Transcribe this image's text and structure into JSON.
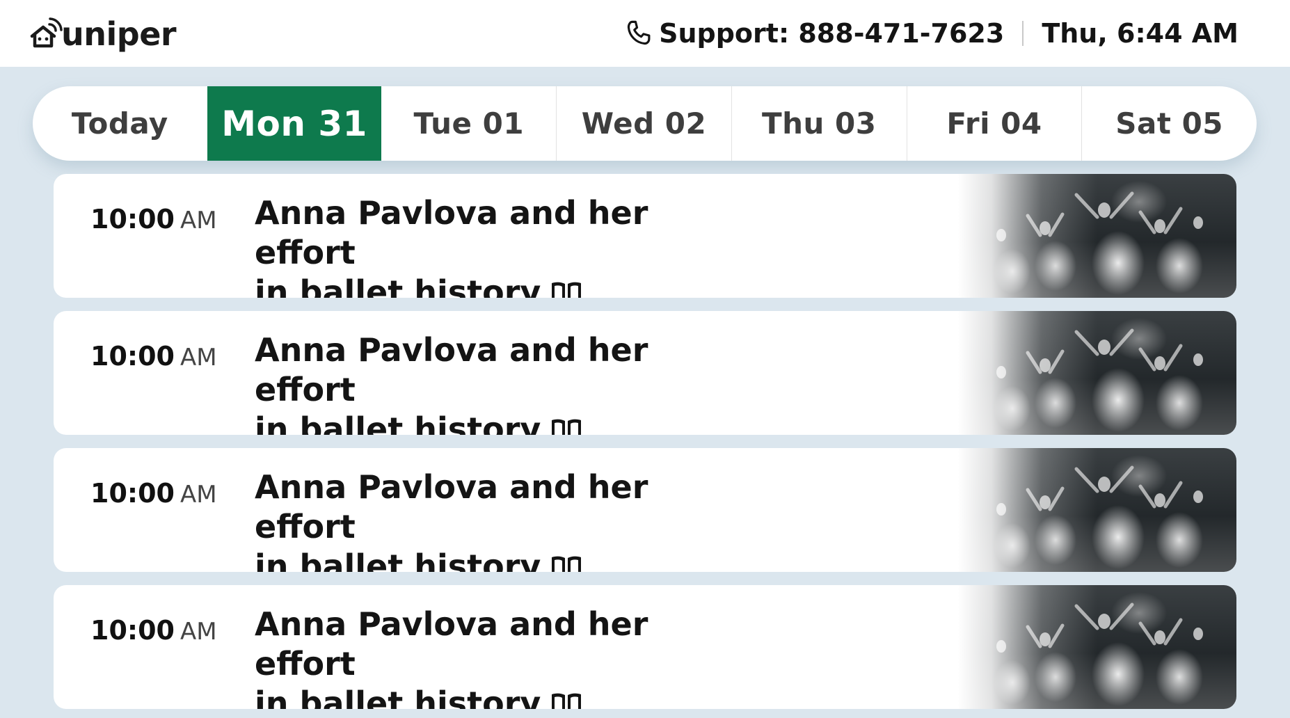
{
  "header": {
    "brand": "uniper",
    "support_label": "Support: 888-471-7623",
    "datetime": "Thu, 6:44 AM"
  },
  "tabs": [
    {
      "label": "Today",
      "active": false
    },
    {
      "label": "Mon 31",
      "active": true
    },
    {
      "label": "Tue 01",
      "active": false
    },
    {
      "label": "Wed 02",
      "active": false
    },
    {
      "label": "Thu 03",
      "active": false
    },
    {
      "label": "Fri 04",
      "active": false
    },
    {
      "label": "Sat 05",
      "active": false
    }
  ],
  "events": [
    {
      "time": "10:00",
      "ampm": "AM",
      "title_line1": "Anna Pavlova and her effort",
      "title_line2": "in ballet history",
      "icon": "book-icon",
      "image": "ballet-dancers-image"
    },
    {
      "time": "10:00",
      "ampm": "AM",
      "title_line1": "Anna Pavlova and her effort",
      "title_line2": "in ballet history",
      "icon": "book-icon",
      "image": "ballet-dancers-image"
    },
    {
      "time": "10:00",
      "ampm": "AM",
      "title_line1": "Anna Pavlova and her effort",
      "title_line2": "in ballet history",
      "icon": "book-icon",
      "image": "ballet-dancers-image"
    },
    {
      "time": "10:00",
      "ampm": "AM",
      "title_line1": "Anna Pavlova and her effort",
      "title_line2": "in ballet history",
      "icon": "book-icon",
      "image": "ballet-dancers-image"
    }
  ],
  "colors": {
    "accent": "#0e7a4d",
    "background": "#dbe6ee",
    "card": "#ffffff",
    "text": "#141414"
  }
}
